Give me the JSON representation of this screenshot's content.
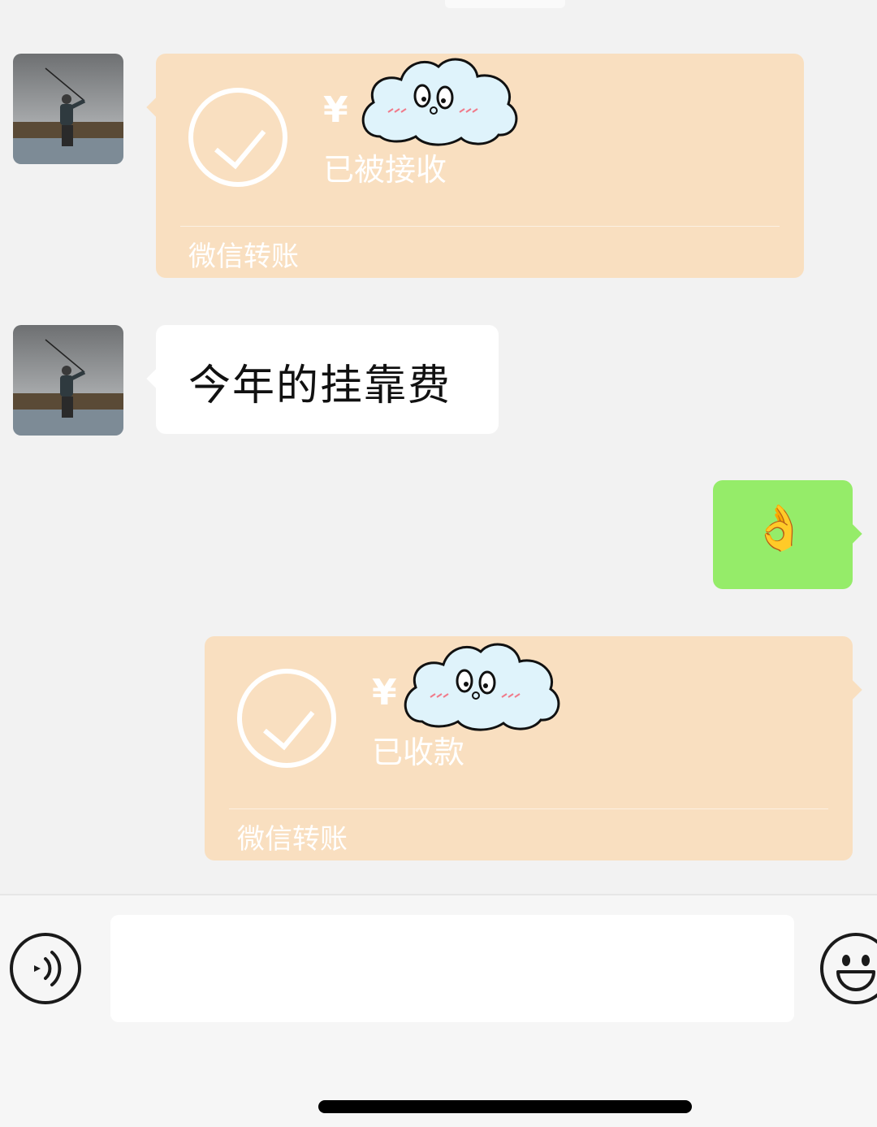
{
  "messages": {
    "transfer_received": {
      "amount": "¥",
      "status": "已被接收",
      "footer": "微信转账"
    },
    "text_message": {
      "text": "今年的挂靠费"
    },
    "reply_emoji": {
      "text": "👌"
    },
    "transfer_collected": {
      "amount": "¥",
      "status": "已收款",
      "footer": "微信转账"
    }
  },
  "colors": {
    "background": "#f2f2f2",
    "transfer_bubble": "#f9dfc0",
    "outgoing_bubble": "#95ec69",
    "incoming_bubble": "#ffffff"
  },
  "icons": {
    "avatar": "fisherman-photo",
    "transfer_status": "check-circle-icon",
    "sticker": "cloud-face-sticker",
    "voice": "voice-icon",
    "emoji": "smiley-icon"
  }
}
